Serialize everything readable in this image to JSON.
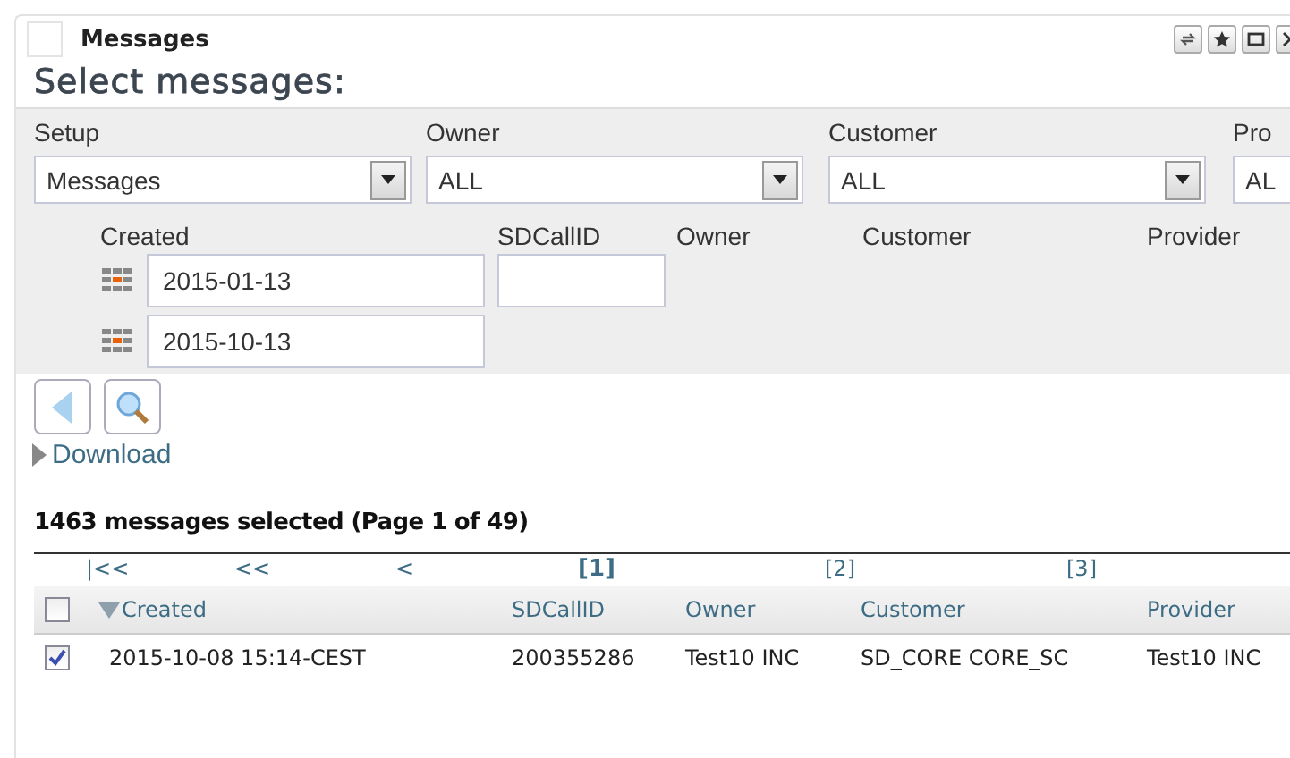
{
  "window": {
    "title": "Messages"
  },
  "heading": "Select messages:",
  "filters": [
    {
      "label": "Setup",
      "value": "Messages"
    },
    {
      "label": "Owner",
      "value": "ALL"
    },
    {
      "label": "Customer",
      "value": "ALL"
    },
    {
      "label": "Pro",
      "value": "AL"
    }
  ],
  "criteria": {
    "columns": [
      "Created",
      "SDCallID",
      "Owner",
      "Customer",
      "Provider"
    ],
    "created_from": "2015-01-13",
    "created_to": "2015-10-13"
  },
  "download_link": "Download",
  "summary": "1463 messages selected (Page 1 of 49)",
  "pager": [
    {
      "label": "|<<",
      "selected": false
    },
    {
      "label": "<<",
      "selected": false
    },
    {
      "label": "<",
      "selected": false
    },
    {
      "label": "[1]",
      "selected": true
    },
    {
      "label": "[2]",
      "selected": false
    },
    {
      "label": "[3]",
      "selected": false
    }
  ],
  "table": {
    "select_all_checked": false,
    "columns": [
      {
        "label": "Created",
        "sorted": true
      },
      {
        "label": "SDCallID",
        "sorted": false
      },
      {
        "label": "Owner",
        "sorted": false
      },
      {
        "label": "Customer",
        "sorted": false
      },
      {
        "label": "Provider",
        "sorted": false
      }
    ],
    "rows": [
      {
        "checked": true,
        "cells": [
          "2015-10-08 15:14-CEST",
          "200355286",
          "Test10 INC",
          "SD_CORE CORE_SC",
          "Test10 INC"
        ]
      }
    ]
  }
}
